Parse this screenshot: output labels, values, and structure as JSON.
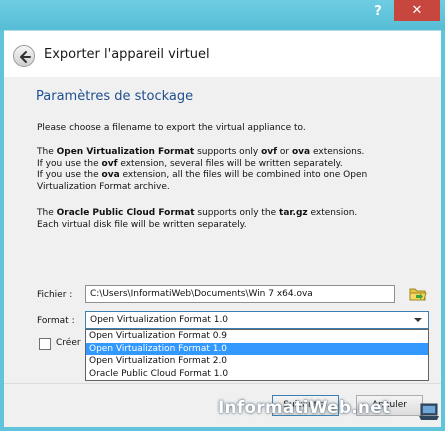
{
  "titlebar": {
    "help_label": "?",
    "close_label": "✕"
  },
  "header": {
    "title": "Exporter l'appareil virtuel"
  },
  "section": {
    "title": "Paramètres de stockage"
  },
  "description": {
    "intro": "Please choose a filename to export the virtual appliance to.",
    "ovf_line1_a": "The ",
    "ovf_line1_b": "Open Virtualization Format",
    "ovf_line1_c": " supports only ",
    "ovf_line1_d": "ovf",
    "ovf_line1_e": " or ",
    "ovf_line1_f": "ova",
    "ovf_line1_g": " extensions.",
    "ovf_line2_a": "If you use the ",
    "ovf_line2_b": "ovf",
    "ovf_line2_c": " extension, several files will be written separately.",
    "ovf_line3_a": "If you use the ",
    "ovf_line3_b": "ova",
    "ovf_line3_c": " extension, all the files will be combined into one Open",
    "ovf_line4": "Virtualization Format archive.",
    "opc_line1_a": "The ",
    "opc_line1_b": "Oracle Public Cloud Format",
    "opc_line1_c": " supports only the ",
    "opc_line1_d": "tar.gz",
    "opc_line1_e": " extension.",
    "opc_line2": "Each virtual disk file will be written separately."
  },
  "file": {
    "label": "Fichier :",
    "value": "C:\\Users\\InformatiWeb\\Documents\\Win 7 x64.ova"
  },
  "format": {
    "label": "Format :",
    "selected": "Open Virtualization Format 1.0",
    "options": [
      "Open Virtualization Format 0.9",
      "Open Virtualization Format 1.0",
      "Open Virtualization Format 2.0",
      "Oracle Public Cloud Format 1.0"
    ],
    "highlighted_index": 1
  },
  "checkbox": {
    "label": "Créer"
  },
  "buttons": {
    "next_label": "Suivant >",
    "cancel_label": "Annuler"
  },
  "watermark": {
    "text": "InformatiWeb.net"
  },
  "colors": {
    "accent": "#3399ff",
    "title_blue": "#1f4f8f",
    "titlebar": "#5fc4dc",
    "close": "#c7463e"
  }
}
